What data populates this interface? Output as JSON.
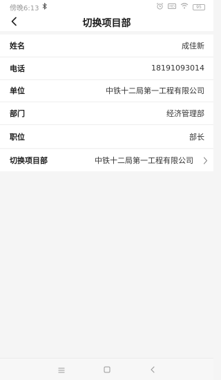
{
  "status_bar": {
    "time": "傍晚6:13",
    "bluetooth_icon": "bluetooth-icon",
    "right_icons": [
      "alarm-icon",
      "hd-icon",
      "wifi-icon"
    ],
    "battery": "95"
  },
  "header": {
    "back_icon": "chevron-left-icon",
    "title": "切换项目部"
  },
  "info": {
    "rows": [
      {
        "label": "姓名",
        "value": "成佳新"
      },
      {
        "label": "电话",
        "value": "18191093014"
      },
      {
        "label": "单位",
        "value": "中铁十二局第一工程有限公司"
      },
      {
        "label": "部门",
        "value": "经济管理部"
      },
      {
        "label": "职位",
        "value": "部长"
      }
    ]
  },
  "switch": {
    "label": "切换项目部",
    "value": "中铁十二局第一工程有限公司",
    "chevron_icon": "chevron-right-icon"
  },
  "nav_bar": {
    "icons": [
      "menu-icon",
      "home-square-icon",
      "back-triangle-icon"
    ]
  }
}
